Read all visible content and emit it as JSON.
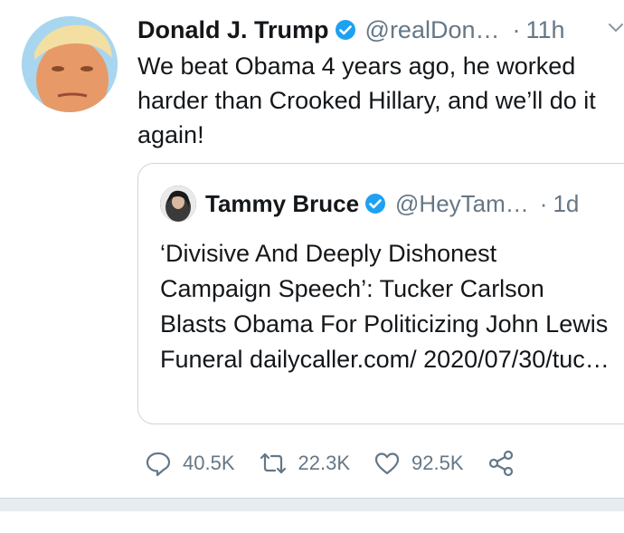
{
  "tweet": {
    "author_name": "Donald J. Trump",
    "handle": "@realDon…",
    "separator": "·",
    "time": "11h",
    "text": "We beat Obama 4 years ago, he worked harder than Crooked Hillary, and we’ll do it again!"
  },
  "quote": {
    "author_name": "Tammy Bruce",
    "handle": "@HeyTam…",
    "separator": "·",
    "time": "1d",
    "text": "‘Divisive And Deeply Dishonest Campaign Speech’: Tucker Carlson Blasts Obama For Politicizing John Lewis Funeral dailycaller.com/ 2020/07/30/tuc…"
  },
  "actions": {
    "reply_count": "40.5K",
    "retweet_count": "22.3K",
    "like_count": "92.5K"
  },
  "colors": {
    "verified_blue": "#1da1f2",
    "secondary_text": "#657786",
    "border": "#ccd6dd"
  },
  "icons": {
    "reply": "speech-bubble-icon",
    "retweet": "retweet-arrows-icon",
    "like": "heart-outline-icon",
    "share": "share-nodes-icon",
    "more": "chevron-down-icon",
    "verified": "verified-badge-icon"
  }
}
